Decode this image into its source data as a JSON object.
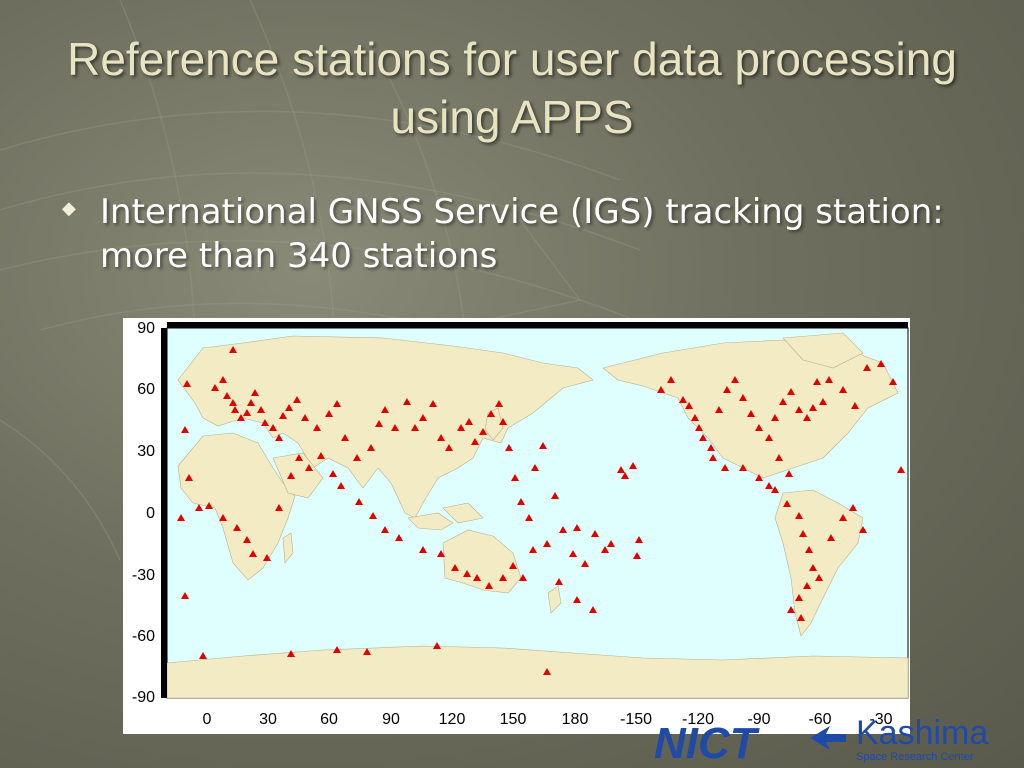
{
  "slide": {
    "title": "Reference stations for user data processing using APPS",
    "bullet": "International GNSS Service (IGS) tracking station: more than 340 stations"
  },
  "map": {
    "y_ticks": [
      "90",
      "60",
      "30",
      "0",
      "-30",
      "-60",
      "-90"
    ],
    "x_ticks": [
      "0",
      "30",
      "60",
      "90",
      "120",
      "150",
      "180",
      "-150",
      "-120",
      "-90",
      "-60",
      "-30"
    ],
    "colors": {
      "ocean": "#dfffff",
      "land": "#f2ebc3",
      "marker": "#e00000"
    }
  },
  "logos": {
    "nict": "NICT",
    "kashima": "Kashima",
    "kashima_sub": "Space Research Center"
  }
}
